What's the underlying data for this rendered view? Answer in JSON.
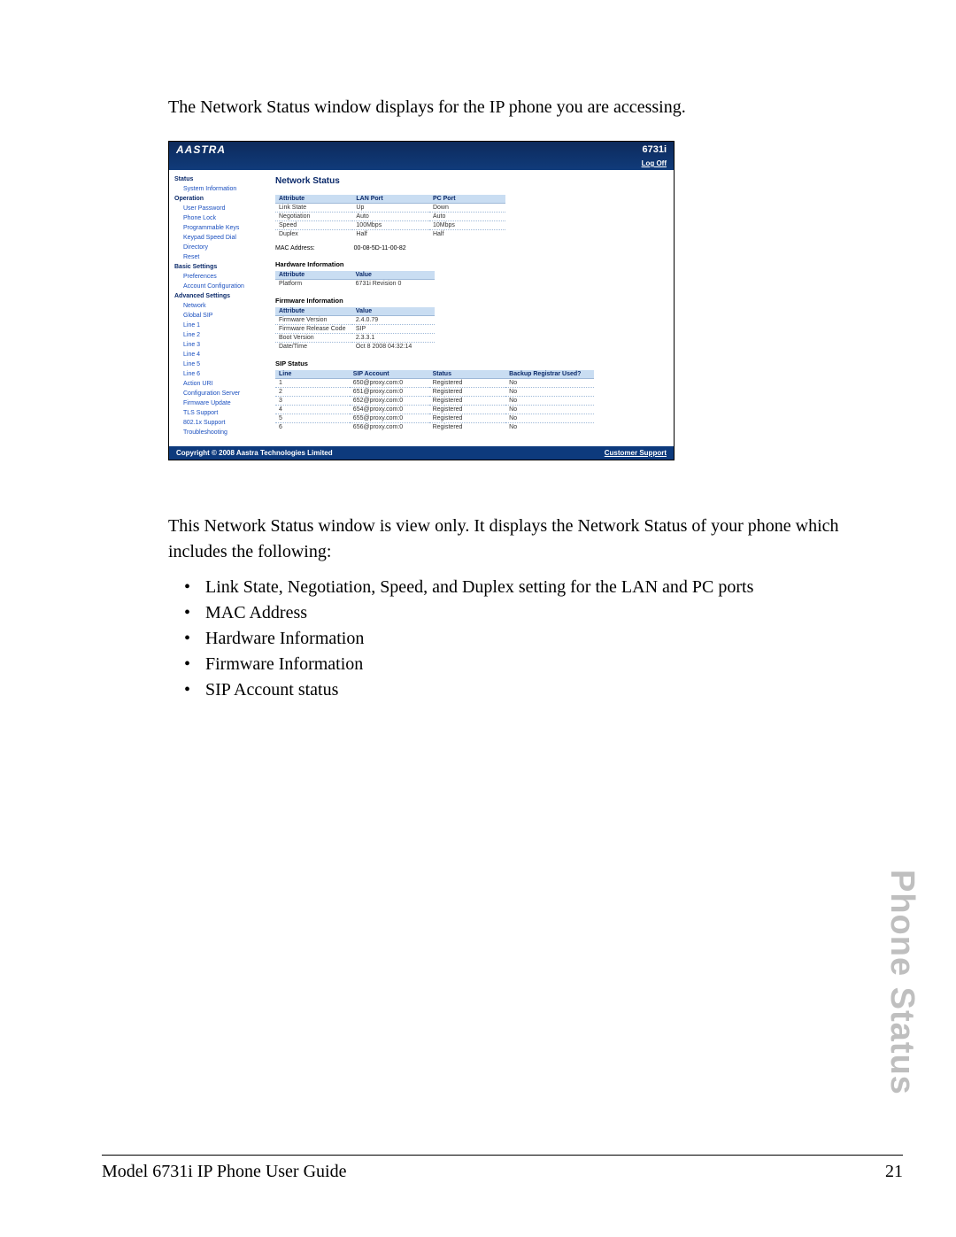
{
  "doc": {
    "intro": "The Network Status window displays for the IP phone you are accessing.",
    "after1": "This Network Status window is view only. It displays the Network Status of your phone which includes the following:",
    "bullets": [
      "Link State, Negotiation, Speed, and Duplex setting for the LAN and PC ports",
      "MAC Address",
      "Hardware Information",
      "Firmware Information",
      "SIP Account status"
    ],
    "side_title": "Phone Status",
    "footer_left": "Model 6731i IP Phone User Guide",
    "footer_right": "21"
  },
  "hdr": {
    "logo": "AASTRA",
    "model": "6731i",
    "logoff": "Log Off"
  },
  "side": [
    {
      "t": "g",
      "l": "Status"
    },
    {
      "t": "i",
      "l": "System Information"
    },
    {
      "t": "g",
      "l": "Operation"
    },
    {
      "t": "i",
      "l": "User Password"
    },
    {
      "t": "i",
      "l": "Phone Lock"
    },
    {
      "t": "i",
      "l": "Programmable Keys"
    },
    {
      "t": "i",
      "l": "Keypad Speed Dial"
    },
    {
      "t": "i",
      "l": "Directory"
    },
    {
      "t": "i",
      "l": "Reset"
    },
    {
      "t": "g",
      "l": "Basic Settings"
    },
    {
      "t": "i",
      "l": "Preferences"
    },
    {
      "t": "i",
      "l": "Account Configuration"
    },
    {
      "t": "g",
      "l": "Advanced Settings"
    },
    {
      "t": "i",
      "l": "Network"
    },
    {
      "t": "i",
      "l": "Global SIP"
    },
    {
      "t": "i",
      "l": "Line 1"
    },
    {
      "t": "i",
      "l": "Line 2"
    },
    {
      "t": "i",
      "l": "Line 3"
    },
    {
      "t": "i",
      "l": "Line 4"
    },
    {
      "t": "i",
      "l": "Line 5"
    },
    {
      "t": "i",
      "l": "Line 6"
    },
    {
      "t": "i",
      "l": "Action URI"
    },
    {
      "t": "i",
      "l": "Configuration Server"
    },
    {
      "t": "i",
      "l": "Firmware Update"
    },
    {
      "t": "i",
      "l": "TLS Support"
    },
    {
      "t": "i",
      "l": "802.1x Support"
    },
    {
      "t": "i",
      "l": "Troubleshooting"
    }
  ],
  "main": {
    "title": "Network Status",
    "net_hdr": [
      "Attribute",
      "LAN Port",
      "PC Port"
    ],
    "net_rows": [
      [
        "Link State",
        "Up",
        "Down"
      ],
      [
        "Negotiation",
        "Auto",
        "Auto"
      ],
      [
        "Speed",
        "100Mbps",
        "10Mbps"
      ],
      [
        "Duplex",
        "Half",
        "Half"
      ]
    ],
    "mac_label": "MAC Address:",
    "mac_value": "00-08-5D-11-00-82",
    "hw_title": "Hardware Information",
    "hw_hdr": [
      "Attribute",
      "Value"
    ],
    "hw_rows": [
      [
        "Platform",
        "6731i Revision 0"
      ]
    ],
    "fw_title": "Firmware Information",
    "fw_hdr": [
      "Attribute",
      "Value"
    ],
    "fw_rows": [
      [
        "Firmware Version",
        "2.4.0.79"
      ],
      [
        "Firmware Release Code",
        "SIP"
      ],
      [
        "Boot Version",
        "2.3.3.1"
      ],
      [
        "Date/Time",
        "Oct 8 2008 04:32:14"
      ]
    ],
    "sip_title": "SIP Status",
    "sip_hdr": [
      "Line",
      "SIP Account",
      "Status",
      "Backup Registrar Used?"
    ],
    "sip_rows": [
      [
        "1",
        "650@proxy.com:0",
        "Registered",
        "No"
      ],
      [
        "2",
        "651@proxy.com:0",
        "Registered",
        "No"
      ],
      [
        "3",
        "652@proxy.com:0",
        "Registered",
        "No"
      ],
      [
        "4",
        "654@proxy.com:0",
        "Registered",
        "No"
      ],
      [
        "5",
        "655@proxy.com:0",
        "Registered",
        "No"
      ],
      [
        "6",
        "656@proxy.com:0",
        "Registered",
        "No"
      ]
    ]
  },
  "ftr": {
    "copy": "Copyright © 2008 Aastra Technologies Limited",
    "support": "Customer Support"
  }
}
